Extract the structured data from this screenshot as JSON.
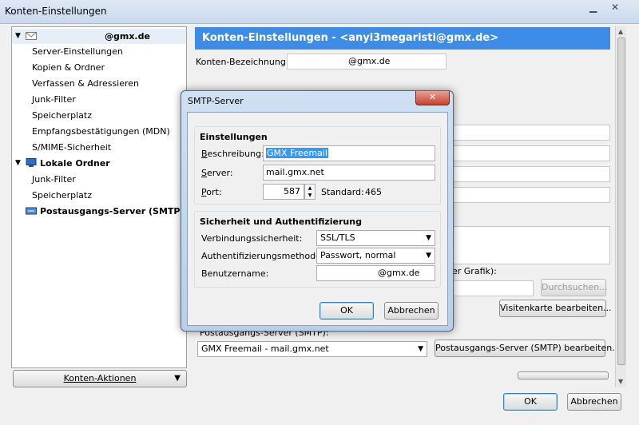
{
  "window": {
    "title": "Konten-Einstellungen",
    "minimize": "▁",
    "close": "✕"
  },
  "sidebar": {
    "account": "@gmx.de",
    "account_items": [
      "Server-Einstellungen",
      "Kopien & Ordner",
      "Verfassen & Adressieren",
      "Junk-Filter",
      "Speicherplatz",
      "Empfangsbestätigungen (MDN)",
      "S/MIME-Sicherheit"
    ],
    "local_folders": "Lokale Ordner",
    "local_items": [
      "Junk-Filter",
      "Speicherplatz"
    ],
    "smtp": "Postausgangs-Server (SMTP)",
    "actions_button": "Konten-Aktionen"
  },
  "content": {
    "banner": "Konten-Einstellungen - <anyi3megaristi@gmx.de>",
    "account_name_label": "Konten-Bezeichnung:",
    "account_name_value": "@gmx.de",
    "graphic_hint": "er Grafik):",
    "browse_button": "Durchsuchen...",
    "vcard_button": "Visitenkarte bearbeiten...",
    "smtp_label": "Postausgangs-Server (SMTP):",
    "smtp_select": "GMX Freemail - mail.gmx.net",
    "smtp_edit_button": "Postausgangs-Server (SMTP) bearbeiten..."
  },
  "footer": {
    "ok": "OK",
    "cancel": "Abbrechen"
  },
  "dialog": {
    "title": "SMTP-Server",
    "close": "✕",
    "settings_group": "Einstellungen",
    "description_label": "Beschreibung:",
    "description_value": "GMX Freemail",
    "server_label": "Server:",
    "server_value": "mail.gmx.net",
    "port_label": "Port:",
    "port_value": "587",
    "standard_label": "Standard:",
    "standard_value": "465",
    "security_group": "Sicherheit und Authentifizierung",
    "conn_security_label": "Verbindungssicherheit:",
    "conn_security_value": "SSL/TLS",
    "auth_label": "Authentifizierungsmethode:",
    "auth_value": "Passwort, normal",
    "username_label": "Benutzername:",
    "username_value": "@gmx.de",
    "ok": "OK",
    "cancel": "Abbrechen"
  }
}
